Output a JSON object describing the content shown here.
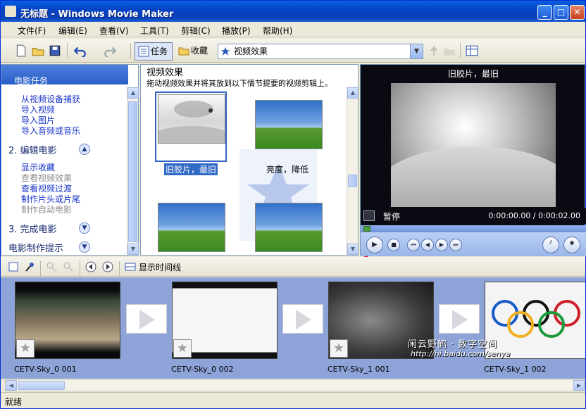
{
  "window": {
    "title": "无标题 - Windows Movie Maker"
  },
  "menu": [
    "文件(F)",
    "编辑(E)",
    "查看(V)",
    "工具(T)",
    "剪辑(C)",
    "播放(P)",
    "帮助(H)"
  ],
  "toolbar": {
    "tasks_label": "任务",
    "collections_label": "收藏",
    "collection_value": "视频效果"
  },
  "taskpane": {
    "title": "电影任务",
    "capture_links": [
      "从视频设备捕获",
      "导入视频",
      "导入图片",
      "导入音频或音乐"
    ],
    "section2": "2. 编辑电影",
    "edit_links": [
      {
        "label": "显示收藏",
        "enabled": true
      },
      {
        "label": "查看视频效果",
        "enabled": false
      },
      {
        "label": "查看视频过渡",
        "enabled": true
      },
      {
        "label": "制作片头或片尾",
        "enabled": true
      },
      {
        "label": "制作自动电影",
        "enabled": false
      }
    ],
    "section3": "3. 完成电影",
    "tips": "电影制作提示"
  },
  "effects": {
    "title": "视频效果",
    "description": "拖动视频效果并将其放到以下情节提要的视频剪辑上。",
    "items": [
      "旧胶片，最旧",
      "亮度，降低"
    ]
  },
  "monitor": {
    "title": "旧胶片，最旧",
    "status": "暂停",
    "time": "0:00:00.00 / 0:00:02.00"
  },
  "storyboard": {
    "show_timeline": "显示时间线",
    "clips": [
      "CETV-Sky_0 001",
      "CETV-Sky_0 002",
      "CETV-Sky_1 001",
      "CETV-Sky_1 002"
    ]
  },
  "watermark": {
    "line1": "闲云野鹤 · 数字空间",
    "line2": "http://hi.baidu.com/senya"
  },
  "statusbar": {
    "text": "就绪"
  }
}
